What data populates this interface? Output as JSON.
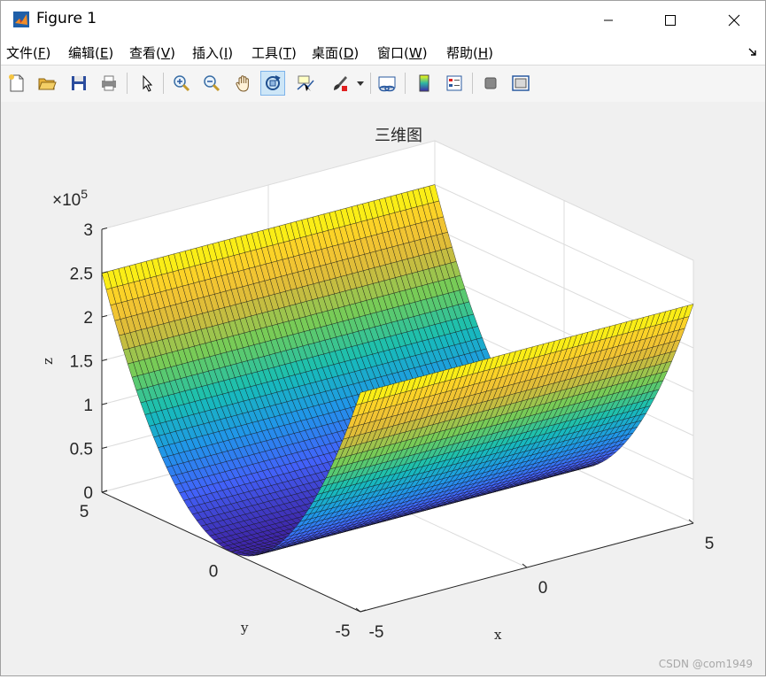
{
  "window": {
    "title": "Figure 1",
    "minimize_icon": "minimize-icon",
    "maximize_icon": "maximize-icon",
    "close_icon": "close-icon"
  },
  "menu": {
    "items": [
      {
        "label": "文件(",
        "key": "F",
        "tail": ")"
      },
      {
        "label": "编辑(",
        "key": "E",
        "tail": ")"
      },
      {
        "label": "查看(",
        "key": "V",
        "tail": ")"
      },
      {
        "label": "插入(",
        "key": "I",
        "tail": ")"
      },
      {
        "label": "工具(",
        "key": "T",
        "tail": ")"
      },
      {
        "label": "桌面(",
        "key": "D",
        "tail": ")"
      },
      {
        "label": "窗口(",
        "key": "W",
        "tail": ")"
      },
      {
        "label": "帮助(",
        "key": "H",
        "tail": ")"
      }
    ]
  },
  "toolbar": {
    "buttons": [
      "new-figure-icon",
      "open-file-icon",
      "save-icon",
      "print-icon",
      "select-arrow-icon",
      "zoom-in-icon",
      "zoom-out-icon",
      "pan-hand-icon",
      "rotate-3d-icon",
      "data-cursor-icon",
      "brush-icon",
      "brush-dropdown-icon",
      "link-plot-icon",
      "colorbar-icon",
      "legend-icon",
      "hide-plot-tools-icon",
      "show-plot-tools-icon"
    ],
    "active": "rotate-3d-icon"
  },
  "chart_data": {
    "type": "surface",
    "title": "三维图",
    "xlabel": "x",
    "ylabel": "y",
    "zlabel": "z",
    "exponent_label": "×10",
    "exponent_power": "5",
    "xlim": [
      -5,
      5
    ],
    "ylim": [
      -5,
      5
    ],
    "zlim": [
      0,
      300000
    ],
    "x_ticks": [
      "-5",
      "0",
      "5"
    ],
    "y_ticks": [
      "-5",
      "0",
      "5"
    ],
    "z_ticks": [
      "0",
      "0.5",
      "1",
      "1.5",
      "2",
      "2.5",
      "3"
    ],
    "z_max": 250000,
    "colormap": "parula",
    "grid": true
  },
  "watermark": "CSDN @com1949"
}
